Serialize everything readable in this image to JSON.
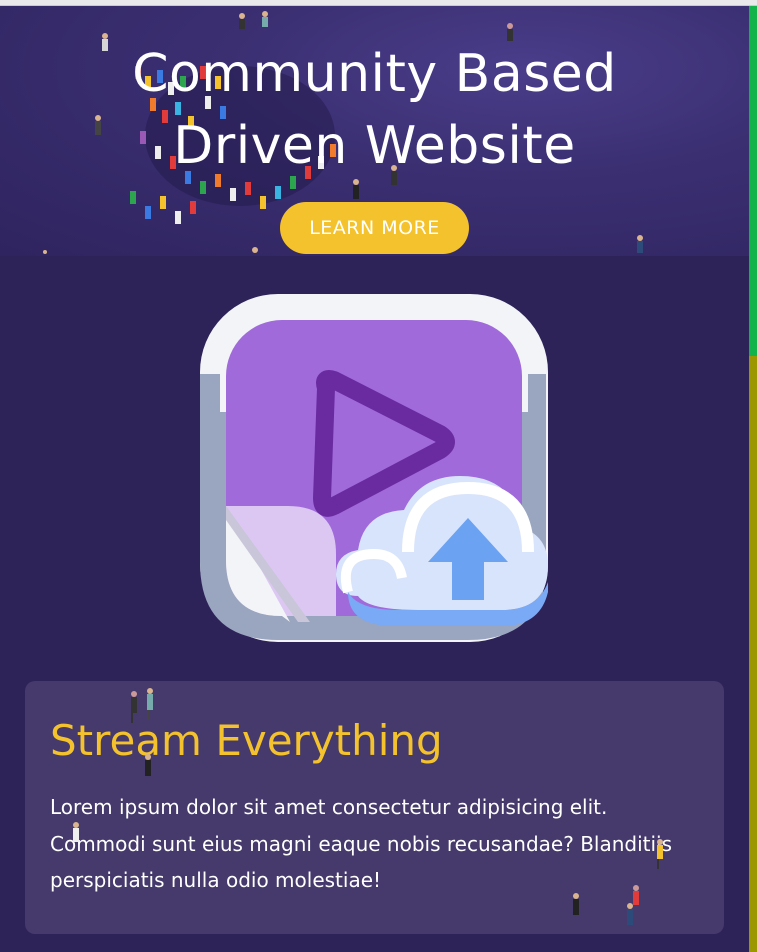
{
  "hero": {
    "title_line1": "Community Based",
    "title_line2": "Driven Website",
    "button_label": "LEARN MORE"
  },
  "feature": {
    "icon": "video-upload-icon",
    "title": "Stream Everything",
    "text": "Lorem ipsum dolor sit amet consectetur adipisicing elit. Commodi sunt eius magni eaque nobis recusandae? Blanditiis perspiciatis nulla odio molestiae!"
  },
  "colors": {
    "accent": "#f4c22c",
    "background": "#2d2359",
    "card": "#453a6b",
    "scroll_thumb": "#12b34a",
    "scroll_track": "#9a9700"
  }
}
